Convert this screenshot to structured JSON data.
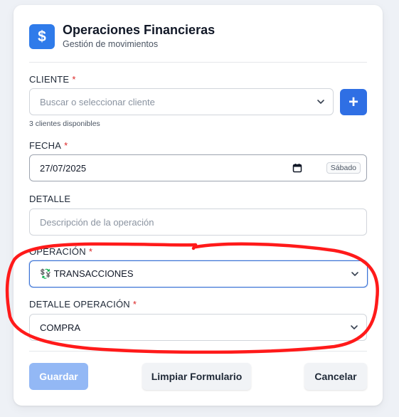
{
  "header": {
    "icon": "dollar-icon",
    "icon_glyph": "$",
    "title": "Operaciones Financieras",
    "subtitle": "Gestión de movimientos"
  },
  "cliente": {
    "label": "CLIENTE",
    "required_mark": "*",
    "placeholder": "Buscar o seleccionar cliente",
    "add_icon": "plus-icon",
    "add_glyph": "+",
    "hint": "3 clientes disponibles"
  },
  "fecha": {
    "label": "FECHA",
    "required_mark": "*",
    "value": "27/07/2025",
    "day": "Sábado",
    "icon": "calendar-icon"
  },
  "detalle": {
    "label": "DETALLE",
    "placeholder": "Descripción de la operación"
  },
  "operacion": {
    "label": "OPERACIÓN",
    "required_mark": "*",
    "value": "💱 TRANSACCIONES"
  },
  "detalle_operacion": {
    "label": "DETALLE OPERACIÓN",
    "required_mark": "*",
    "value": "COMPRA"
  },
  "actions": {
    "save_label": "Guardar",
    "clear_label": "Limpiar Formulario",
    "cancel_label": "Cancelar"
  },
  "colors": {
    "primary": "#2f7bea",
    "required": "#dc2626",
    "focus_border": "#2f6fe4",
    "annotation": "#ff1a1a"
  }
}
